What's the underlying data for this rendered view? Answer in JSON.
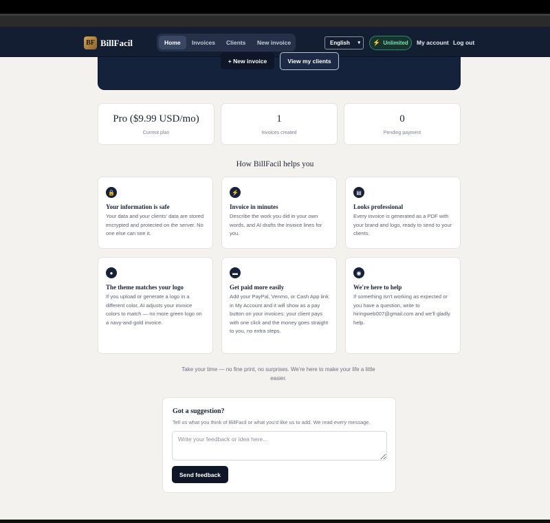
{
  "brand": {
    "logo_initials": "BF",
    "name": "BillFacil"
  },
  "nav": {
    "links": [
      {
        "label": "Home",
        "active": true
      },
      {
        "label": "Invoices",
        "active": false
      },
      {
        "label": "Clients",
        "active": false
      },
      {
        "label": "New invoice",
        "active": false
      }
    ],
    "language": "English",
    "plan_badge": "Unlimited",
    "my_account": "My account",
    "log_out": "Log out"
  },
  "hero": {
    "new_invoice_button": "+ New invoice",
    "view_clients_button": "View my clients"
  },
  "stats": [
    {
      "value": "Pro ($9.99 USD/mo)",
      "label": "Current plan"
    },
    {
      "value": "1",
      "label": "Invoices created"
    },
    {
      "value": "0",
      "label": "Pending payment"
    }
  ],
  "features_title": "How BillFacil helps you",
  "features": [
    {
      "icon": "lock-icon",
      "title": "Your information is safe",
      "text": "Your data and your clients' data are stored encrypted and protected on the server. No one else can see it."
    },
    {
      "icon": "lightning-icon",
      "title": "Invoice in minutes",
      "text": "Describe the work you did in your own words, and AI drafts the invoice lines for you."
    },
    {
      "icon": "document-icon",
      "title": "Looks professional",
      "text": "Every invoice is generated as a PDF with your brand and logo, ready to send to your clients."
    },
    {
      "icon": "palette-icon",
      "title": "The theme matches your logo",
      "text": "If you upload or generate a logo in a different color, AI adjusts your invoice colors to match — no more green logo on a navy-and-gold invoice."
    },
    {
      "icon": "credit-card-icon",
      "title": "Get paid more easily",
      "text": "Add your PayPal, Venmo, or Cash App link in My Account and it will show as a pay button on your invoices: your client pays with one click and the money goes straight to you, no extra steps."
    },
    {
      "icon": "speech-bubble-icon",
      "title": "We're here to help",
      "text": "If something isn't working as expected or you have a question, write to hiringweb007@gmail.com and we'll gladly help."
    }
  ],
  "tagline": "Take your time — no fine print, no surprises. We're here to make your life a little easier.",
  "feedback": {
    "title": "Got a suggestion?",
    "subtitle": "Tell us what you think of BillFacil or what you'd like us to add. We read every message.",
    "placeholder": "Write your feedback or idea here...",
    "value": "",
    "button": "Send feedback"
  }
}
